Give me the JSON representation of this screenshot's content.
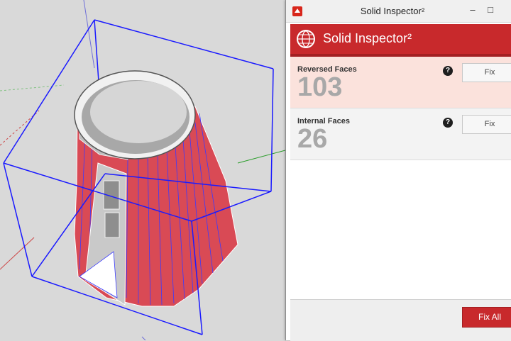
{
  "window": {
    "title": "Solid Inspector²",
    "minimize_glyph": "–",
    "maximize_glyph": "□"
  },
  "header": {
    "title": "Solid Inspector²"
  },
  "issues": [
    {
      "label": "Reversed Faces",
      "count": "103",
      "fix_label": "Fix",
      "help_glyph": "?"
    },
    {
      "label": "Internal Faces",
      "count": "26",
      "fix_label": "Fix",
      "help_glyph": "?"
    }
  ],
  "footer": {
    "fix_all_label": "Fix All"
  },
  "colors": {
    "accent": "#c8292c",
    "reversed_row_bg": "#fbe2dc",
    "count_text": "#a8a8a8",
    "bounding_box": "#1a1aff",
    "face_red": "#d94a55"
  },
  "icons": {
    "app": "sketchup-icon",
    "logo": "solid-inspector-globe-icon",
    "help": "help-icon"
  }
}
